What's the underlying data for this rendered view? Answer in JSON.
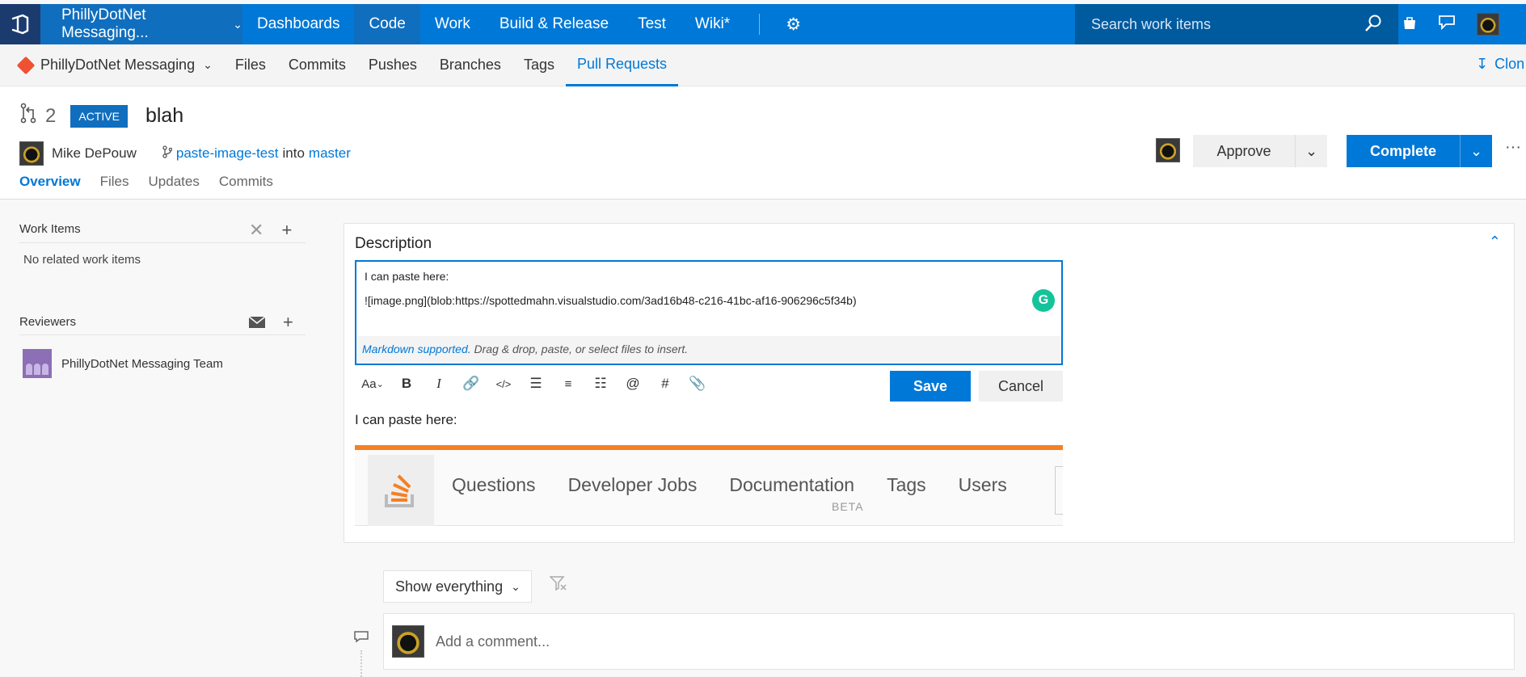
{
  "topbar": {
    "project": "PhillyDotNet Messaging...",
    "nav": [
      "Dashboards",
      "Code",
      "Work",
      "Build & Release",
      "Test",
      "Wiki*"
    ],
    "active_nav": "Code",
    "search_placeholder": "Search work items",
    "brand_color": "#0078d7"
  },
  "subnav": {
    "repo": "PhillyDotNet Messaging",
    "items": [
      "Files",
      "Commits",
      "Pushes",
      "Branches",
      "Tags",
      "Pull Requests"
    ],
    "active": "Pull Requests",
    "clone_label": "Clon"
  },
  "pr": {
    "id": "2",
    "status": "ACTIVE",
    "title": "blah",
    "author": "Mike DePouw",
    "source_branch": "paste-image-test",
    "into_word": "into",
    "target_branch": "master",
    "tabs": [
      "Overview",
      "Files",
      "Updates",
      "Commits"
    ],
    "active_tab": "Overview",
    "approve_label": "Approve",
    "complete_label": "Complete",
    "more_label": "···"
  },
  "left": {
    "work_items_title": "Work Items",
    "work_items_empty": "No related work items",
    "reviewers_title": "Reviewers",
    "reviewer": "PhillyDotNet Messaging Team"
  },
  "description": {
    "title": "Description",
    "editor_line1": "I can paste here:",
    "editor_line2": "![image.png](blob:https://spottedmahn.visualstudio.com/3ad16b48-c216-41bc-af16-906296c5f34b)",
    "markdown_link": "Markdown supported",
    "markdown_hint": ". Drag & drop, paste, or select files to insert.",
    "save_label": "Save",
    "cancel_label": "Cancel",
    "preview_text": "I can paste here:",
    "font_tool": "Aa",
    "pasted_nav": [
      "Questions",
      "Developer Jobs",
      "Documentation",
      "Tags",
      "Users"
    ],
    "pasted_beta": "BETA"
  },
  "bottom": {
    "filter_label": "Show everything",
    "comment_placeholder": "Add a comment..."
  }
}
